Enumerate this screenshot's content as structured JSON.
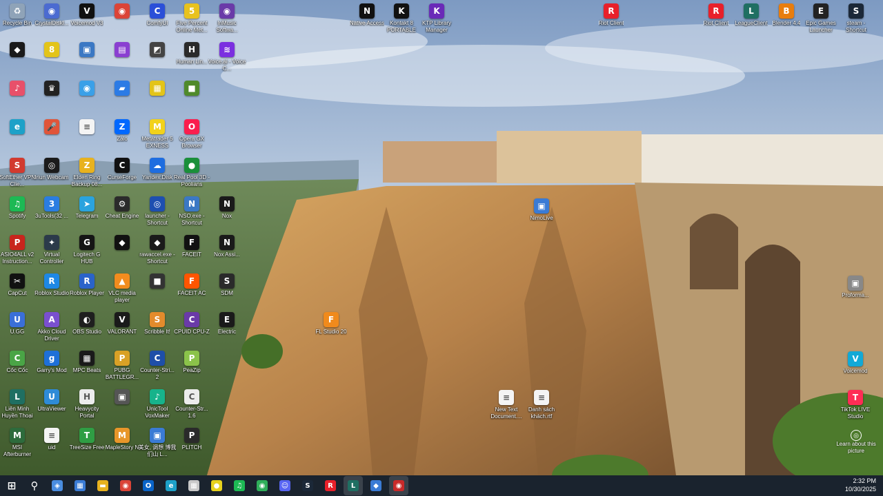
{
  "desktop": {
    "columns": [
      {
        "icons": [
          {
            "label": "Recycle Bin",
            "icon": "recycle-bin-icon",
            "glyph": "♻",
            "color": "#8fa3b8"
          },
          {
            "label": "",
            "icon": "app-icon",
            "glyph": "◆",
            "color": "#1a1a1a"
          },
          {
            "label": "",
            "icon": "itunes-icon",
            "glyph": "♪",
            "color": "#e8506a"
          },
          {
            "label": "",
            "icon": "edge-icon",
            "glyph": "e",
            "color": "#1da1c8"
          },
          {
            "label": "SoftEther VPN Clie...",
            "icon": "softether-icon",
            "glyph": "S",
            "color": "#d23a2f"
          },
          {
            "label": "Spotify",
            "icon": "spotify-icon",
            "glyph": "♫",
            "color": "#1db954"
          },
          {
            "label": "ASIO4ALL v2 Instruction...",
            "icon": "pdf-icon",
            "glyph": "P",
            "color": "#c8251d"
          },
          {
            "label": "CapCut",
            "icon": "capcut-icon",
            "glyph": "✂",
            "color": "#111111"
          },
          {
            "label": "U.GG",
            "icon": "ugg-icon",
            "glyph": "U",
            "color": "#3a6fd8"
          },
          {
            "label": "Cốc Cốc",
            "icon": "coccoc-icon",
            "glyph": "C",
            "color": "#4aa546"
          },
          {
            "label": "Liên Minh Huyền Thoại",
            "icon": "lol-icon",
            "glyph": "L",
            "color": "#1f6f62"
          },
          {
            "label": "MSI Afterburner",
            "icon": "msi-icon",
            "glyph": "M",
            "color": "#2d6b3c"
          }
        ]
      },
      {
        "icons": [
          {
            "label": "CrystalDiskI...",
            "icon": "crystaldisk-icon",
            "glyph": "◉",
            "color": "#4b6bd1"
          },
          {
            "label": "",
            "icon": "app-icon",
            "glyph": "8",
            "color": "#e3c419"
          },
          {
            "label": "",
            "icon": "app-icon",
            "glyph": "♛",
            "color": "#222222"
          },
          {
            "label": "",
            "icon": "mic-icon",
            "glyph": "🎤",
            "color": "#e0553a"
          },
          {
            "label": "Iriun Webcam",
            "icon": "webcam-icon",
            "glyph": "◎",
            "color": "#1b1b1b"
          },
          {
            "label": "3uTools(32 ...",
            "icon": "3utools-icon",
            "glyph": "3",
            "color": "#2a7de1"
          },
          {
            "label": "Virtual Controller",
            "icon": "controller-icon",
            "glyph": "✦",
            "color": "#2b3a4a"
          },
          {
            "label": "Roblox Studio",
            "icon": "roblox-studio-icon",
            "glyph": "R",
            "color": "#1e88e5"
          },
          {
            "label": "Akko Cloud Driver",
            "icon": "akko-icon",
            "glyph": "A",
            "color": "#7a4fcf"
          },
          {
            "label": "Garry's Mod",
            "icon": "gmod-icon",
            "glyph": "g",
            "color": "#1e70d8"
          },
          {
            "label": "UltraViewer",
            "icon": "ultraviewer-icon",
            "glyph": "U",
            "color": "#2e8bd7"
          },
          {
            "label": "uid",
            "icon": "text-file-icon",
            "glyph": "≡",
            "color": "#f4f4f4"
          }
        ]
      },
      {
        "icons": [
          {
            "label": "Voicemod V3",
            "icon": "voicemod-icon",
            "glyph": "V",
            "color": "#101010"
          },
          {
            "label": "",
            "icon": "app-icon",
            "glyph": "▣",
            "color": "#3b78c4"
          },
          {
            "label": "",
            "icon": "app-icon",
            "glyph": "◉",
            "color": "#3aa0e8"
          },
          {
            "label": "",
            "icon": "text-file-icon",
            "glyph": "≡",
            "color": "#f4f4f4"
          },
          {
            "label": "Elden Ring Backup 08...",
            "icon": "zip-icon",
            "glyph": "Z",
            "color": "#e8b21e"
          },
          {
            "label": "Telegram",
            "icon": "telegram-icon",
            "glyph": "➤",
            "color": "#2aa3de"
          },
          {
            "label": "Logitech G HUB",
            "icon": "logitech-icon",
            "glyph": "G",
            "color": "#151515"
          },
          {
            "label": "Roblox Player",
            "icon": "roblox-icon",
            "glyph": "R",
            "color": "#2a63c9"
          },
          {
            "label": "OBS Studio",
            "icon": "obs-icon",
            "glyph": "◐",
            "color": "#1f1f1f"
          },
          {
            "label": "MPC Beats",
            "icon": "mpc-icon",
            "glyph": "▦",
            "color": "#1a1a1a"
          },
          {
            "label": "Heavycity Portal",
            "icon": "heavycity-icon",
            "glyph": "H",
            "color": "#ececec"
          },
          {
            "label": "TreeSize Free",
            "icon": "treesize-icon",
            "glyph": "T",
            "color": "#2f9e44"
          }
        ]
      },
      {
        "icons": [
          {
            "label": "",
            "icon": "chrome-icon",
            "glyph": "◉",
            "color": "#db4437"
          },
          {
            "label": "",
            "icon": "app-icon",
            "glyph": "▤",
            "color": "#8a3fd1"
          },
          {
            "label": "",
            "icon": "app-icon",
            "glyph": "▰",
            "color": "#2c7be5"
          },
          {
            "label": "Zalo",
            "icon": "zalo-icon",
            "glyph": "Z",
            "color": "#0068ff"
          },
          {
            "label": "CurseForge",
            "icon": "curseforge-icon",
            "glyph": "C",
            "color": "#111111"
          },
          {
            "label": "Cheat Engine",
            "icon": "cheat-engine-icon",
            "glyph": "⚙",
            "color": "#2b2b2b"
          },
          {
            "label": "",
            "icon": "app-icon",
            "glyph": "◆",
            "color": "#111111"
          },
          {
            "label": "VLC media player",
            "icon": "vlc-icon",
            "glyph": "▲",
            "color": "#f28c1e"
          },
          {
            "label": "VALORANT",
            "icon": "valorant-icon",
            "glyph": "V",
            "color": "#1a1a1a"
          },
          {
            "label": "PUBG BATTLEGR...",
            "icon": "pubg-icon",
            "glyph": "P",
            "color": "#d9a126"
          },
          {
            "label": "",
            "icon": "app-icon",
            "glyph": "▣",
            "color": "#555555"
          },
          {
            "label": "MapleStory N",
            "icon": "maplestory-icon",
            "glyph": "M",
            "color": "#e8962a"
          }
        ]
      },
      {
        "icons": [
          {
            "label": "ComfyUI",
            "icon": "comfyui-icon",
            "glyph": "C",
            "color": "#2b4fd8"
          },
          {
            "label": "",
            "icon": "app-icon",
            "glyph": "◩",
            "color": "#444444"
          },
          {
            "label": "",
            "icon": "app-icon",
            "glyph": "▦",
            "color": "#e3c419"
          },
          {
            "label": "Metatrader 5 EXNESS",
            "icon": "metatrader-icon",
            "glyph": "M",
            "color": "#f2d21b"
          },
          {
            "label": "Yandex.Disk",
            "icon": "yandex-disk-icon",
            "glyph": "☁",
            "color": "#1e6de0"
          },
          {
            "label": "launcher - Shortcut",
            "icon": "launcher-icon",
            "glyph": "◎",
            "color": "#1e4fb0"
          },
          {
            "label": "rawaccel.exe - Shortcut",
            "icon": "rawaccel-icon",
            "glyph": "◆",
            "color": "#1a1a1a"
          },
          {
            "label": "",
            "icon": "app-icon",
            "glyph": "■",
            "color": "#333333"
          },
          {
            "label": "Scribble It!",
            "icon": "scribble-icon",
            "glyph": "S",
            "color": "#e38b2c"
          },
          {
            "label": "Counter-Stri... 2",
            "icon": "cs2-icon",
            "glyph": "C",
            "color": "#1e4fa8"
          },
          {
            "label": "UnicTool VoxMaker",
            "icon": "voxmaker-icon",
            "glyph": "♪",
            "color": "#17b38b"
          },
          {
            "label": "美女, 调想 博我们山 L...",
            "icon": "image-icon",
            "glyph": "▣",
            "color": "#3a7bd5"
          }
        ]
      },
      {
        "icons": [
          {
            "label": "Five Percent Online Met...",
            "icon": "fivepercent-icon",
            "glyph": "5",
            "color": "#e8c21e"
          },
          {
            "label": "Human Lin...",
            "icon": "app-icon",
            "glyph": "H",
            "color": "#2a2a2a"
          },
          {
            "label": "",
            "icon": "minecraft-icon",
            "glyph": "■",
            "color": "#4f8a2b"
          },
          {
            "label": "Opera GX Browser",
            "icon": "opera-gx-icon",
            "glyph": "O",
            "color": "#fa1e4e"
          },
          {
            "label": "Real Pool 3D - Poolians",
            "icon": "pool-icon",
            "glyph": "●",
            "color": "#1a8f3a"
          },
          {
            "label": "NSO.exe - Shortcut",
            "icon": "nso-icon",
            "glyph": "N",
            "color": "#3b78c4"
          },
          {
            "label": "FACEIT",
            "icon": "faceit-icon",
            "glyph": "F",
            "color": "#111111"
          },
          {
            "label": "FACEIT AC",
            "icon": "faceit-ac-icon",
            "glyph": "F",
            "color": "#ff5500"
          },
          {
            "label": "CPUID CPU-Z",
            "icon": "cpuz-icon",
            "glyph": "C",
            "color": "#6a3aa8"
          },
          {
            "label": "PeaZip",
            "icon": "peazip-icon",
            "glyph": "P",
            "color": "#8bc34a"
          },
          {
            "label": "Counter-Str... 1.6",
            "icon": "cs16-icon",
            "glyph": "C",
            "color": "#ececec"
          },
          {
            "label": "PLITCH",
            "icon": "plitch-icon",
            "glyph": "P",
            "color": "#2a2a2a"
          }
        ]
      },
      {
        "icons": [
          {
            "label": "InMusic Softwa...",
            "icon": "inmusic-icon",
            "glyph": "◉",
            "color": "#6a3aa8"
          },
          {
            "label": "Voice.ai - Voice C...",
            "icon": "voiceai-icon",
            "glyph": "≋",
            "color": "#7b2fe0"
          },
          {
            "label": "",
            "icon": "app-icon",
            "glyph": "",
            "color": "transparent"
          },
          {
            "label": "",
            "icon": "app-icon",
            "glyph": "",
            "color": "transparent"
          },
          {
            "label": "",
            "icon": "app-icon",
            "glyph": "",
            "color": "transparent"
          },
          {
            "label": "Nox",
            "icon": "nox-icon",
            "glyph": "N",
            "color": "#1a1a1a"
          },
          {
            "label": "Nox Assi...",
            "icon": "nox-assist-icon",
            "glyph": "N",
            "color": "#1a1a1a"
          },
          {
            "label": "SDM",
            "icon": "sdm-icon",
            "glyph": "S",
            "color": "#2a2a2a"
          },
          {
            "label": "Electric",
            "icon": "electric-icon",
            "glyph": "E",
            "color": "#1a1a1a"
          }
        ]
      }
    ],
    "top_icons": [
      {
        "label": "Native Access",
        "icon": "native-access-icon",
        "glyph": "N",
        "color": "#111111"
      },
      {
        "label": "Kontakt 8 PORTABLE",
        "icon": "kontakt-icon",
        "glyph": "K",
        "color": "#111111"
      },
      {
        "label": "KTP Library Manager",
        "icon": "ktp-icon",
        "glyph": "K",
        "color": "#6a2ab8"
      }
    ],
    "right_icons": [
      {
        "label": "Riot Client",
        "icon": "riot-client-icon",
        "glyph": "R",
        "color": "#e8202a"
      },
      {
        "label": "Riot Client",
        "icon": "riot-client-icon",
        "glyph": "R",
        "color": "#e8202a"
      },
      {
        "label": "LeagueClient",
        "icon": "league-client-icon",
        "glyph": "L",
        "color": "#1f6f62"
      },
      {
        "label": "Blender 4.4",
        "icon": "blender-icon",
        "glyph": "B",
        "color": "#e87d0d"
      },
      {
        "label": "Epic Games Launcher",
        "icon": "epic-games-icon",
        "glyph": "E",
        "color": "#222222"
      },
      {
        "label": "steam - Shortcut",
        "icon": "steam-icon",
        "glyph": "S",
        "color": "#1b2838"
      }
    ],
    "scattered_icons": [
      {
        "label": "NimoLive",
        "icon": "nimolive-icon",
        "glyph": "▣",
        "color": "#3a7bd5"
      },
      {
        "label": "FL Studio 20",
        "icon": "fl-studio-icon",
        "glyph": "F",
        "color": "#f08a1c"
      },
      {
        "label": "New Text Document....",
        "icon": "text-file-icon",
        "glyph": "≡",
        "color": "#f4f4f4"
      },
      {
        "label": "Danh sách khách.rtf",
        "icon": "rtf-file-icon",
        "glyph": "≡",
        "color": "#f4f4f4"
      },
      {
        "label": "Proforma...",
        "icon": "app-icon",
        "glyph": "▣",
        "color": "#888888"
      },
      {
        "label": "Voicemod",
        "icon": "voicemod-icon",
        "glyph": "V",
        "color": "#12a9d6"
      },
      {
        "label": "TikTok LIVE Studio",
        "icon": "tiktok-live-icon",
        "glyph": "T",
        "color": "#fe2c55"
      }
    ],
    "learn_about": {
      "label": "Learn about this picture",
      "icon": "info-icon",
      "glyph": "◎"
    }
  },
  "taskbar": {
    "items": [
      {
        "name": "start-button",
        "icon": "windows-icon",
        "glyph": "⊞",
        "color": "transparent",
        "active": false
      },
      {
        "name": "search-button",
        "icon": "search-icon",
        "glyph": "⚲",
        "color": "transparent",
        "active": false
      },
      {
        "name": "widgets-button",
        "icon": "widgets-icon",
        "glyph": "◈",
        "color": "#4a8de0",
        "active": false
      },
      {
        "name": "store-button",
        "icon": "store-icon",
        "glyph": "▦",
        "color": "#3a7bd5",
        "active": false
      },
      {
        "name": "explorer-button",
        "icon": "folder-icon",
        "glyph": "▬",
        "color": "#e8b21e",
        "active": false
      },
      {
        "name": "chrome-button",
        "icon": "chrome-icon",
        "glyph": "◉",
        "color": "#db4437",
        "active": false
      },
      {
        "name": "outlook-button",
        "icon": "outlook-icon",
        "glyph": "O",
        "color": "#0a64c8",
        "active": false
      },
      {
        "name": "edge-button",
        "icon": "edge-icon",
        "glyph": "e",
        "color": "#1da1c8",
        "active": false
      },
      {
        "name": "app-button",
        "icon": "app-icon",
        "glyph": "▦",
        "color": "#c8c8c8",
        "active": false
      },
      {
        "name": "app-button",
        "icon": "app-icon",
        "glyph": "●",
        "color": "#e8d21e",
        "active": false
      },
      {
        "name": "spotify-button",
        "icon": "spotify-icon",
        "glyph": "♫",
        "color": "#1db954",
        "active": false
      },
      {
        "name": "app-button",
        "icon": "app-icon",
        "glyph": "◉",
        "color": "#2fae5a",
        "active": false
      },
      {
        "name": "discord-button",
        "icon": "discord-icon",
        "glyph": "☺",
        "color": "#5865f2",
        "active": false
      },
      {
        "name": "steam-button",
        "icon": "steam-icon",
        "glyph": "S",
        "color": "#1b2838",
        "active": false
      },
      {
        "name": "riot-button",
        "icon": "riot-client-icon",
        "glyph": "R",
        "color": "#e8202a",
        "active": false
      },
      {
        "name": "league-button",
        "icon": "league-client-icon",
        "glyph": "L",
        "color": "#1f6f62",
        "active": true
      },
      {
        "name": "app-button",
        "icon": "app-icon",
        "glyph": "◆",
        "color": "#3a7bd5",
        "active": false
      },
      {
        "name": "app-button",
        "icon": "app-icon",
        "glyph": "◉",
        "color": "#c82a2a",
        "active": true
      }
    ],
    "tray": {
      "time": "2:32 PM",
      "date": "10/30/2025"
    }
  }
}
